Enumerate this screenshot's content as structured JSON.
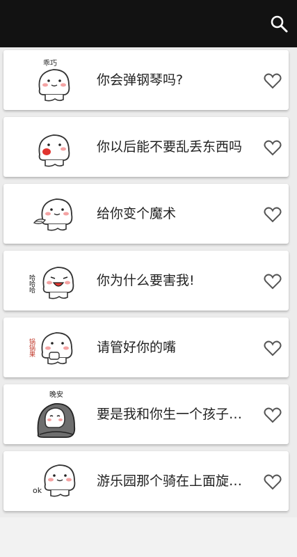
{
  "header": {
    "search_icon": "search-icon",
    "background": "#121212"
  },
  "items": [
    {
      "title": "你会弹钢琴吗?",
      "sticker_text": "乖巧",
      "sticker_icon": "dumpling-face-icon",
      "favorite_icon": "heart-outline-icon"
    },
    {
      "title": "你以后能不要乱丢东西吗",
      "sticker_text": "",
      "sticker_icon": "dumpling-face-icon",
      "favorite_icon": "heart-outline-icon"
    },
    {
      "title": "给你变个魔术",
      "sticker_text": "",
      "sticker_icon": "dumpling-face-icon",
      "favorite_icon": "heart-outline-icon"
    },
    {
      "title": "你为什么要害我!",
      "sticker_text": "哈哈哈",
      "sticker_icon": "dumpling-face-icon",
      "favorite_icon": "heart-outline-icon"
    },
    {
      "title": "请管好你的嘴",
      "sticker_text": "锅锅果",
      "sticker_icon": "dumpling-face-icon",
      "favorite_icon": "heart-outline-icon"
    },
    {
      "title": "要是我和你生一个孩子的话",
      "sticker_text": "晚安",
      "sticker_icon": "dumpling-blanket-icon",
      "favorite_icon": "heart-outline-icon"
    },
    {
      "title": "游乐园那个骑在上面旋转的",
      "sticker_text": "ok",
      "sticker_icon": "dumpling-face-icon",
      "favorite_icon": "heart-outline-icon"
    }
  ]
}
